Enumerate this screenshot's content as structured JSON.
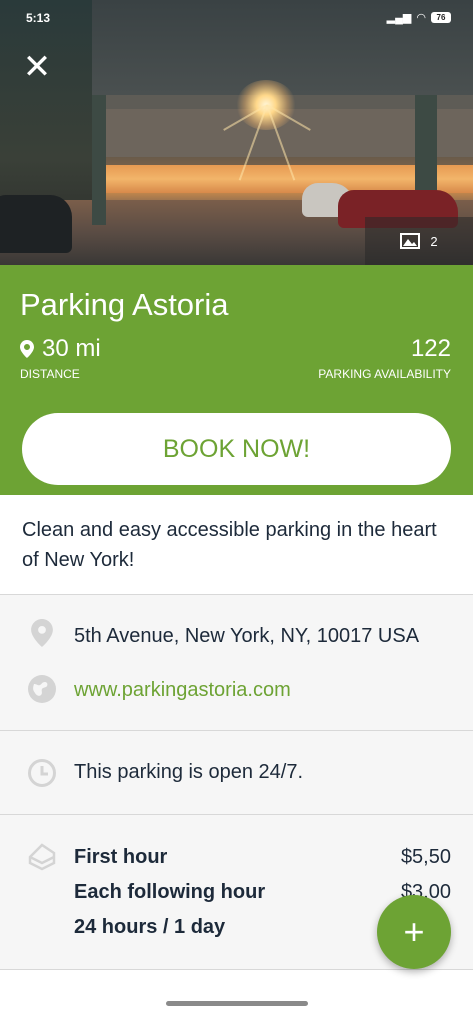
{
  "status_bar": {
    "time": "5:13",
    "battery": "76"
  },
  "hero": {
    "photo_count": "2",
    "icons": {
      "close": "close-icon",
      "gallery": "gallery-icon"
    }
  },
  "header": {
    "title": "Parking Astoria",
    "distance_value": "30 mi",
    "distance_label": "DISTANCE",
    "availability_value": "122",
    "availability_label": "PARKING AVAILABILITY",
    "book_label": "BOOK NOW!"
  },
  "description": "Clean and easy accessible parking in the heart of New York!",
  "contact": {
    "address": "5th Avenue, New York, NY, 10017 USA",
    "website": "www.parkingastoria.com"
  },
  "hours": {
    "text": "This parking is open 24/7."
  },
  "prices": [
    {
      "label": "First hour",
      "value": "$5,50"
    },
    {
      "label": "Each following hour",
      "value": "$3,00"
    },
    {
      "label": "24 hours / 1 day",
      "value": ""
    }
  ],
  "fab": {
    "label": "+"
  },
  "colors": {
    "accent": "#6da334",
    "text": "#1d2a3a"
  }
}
